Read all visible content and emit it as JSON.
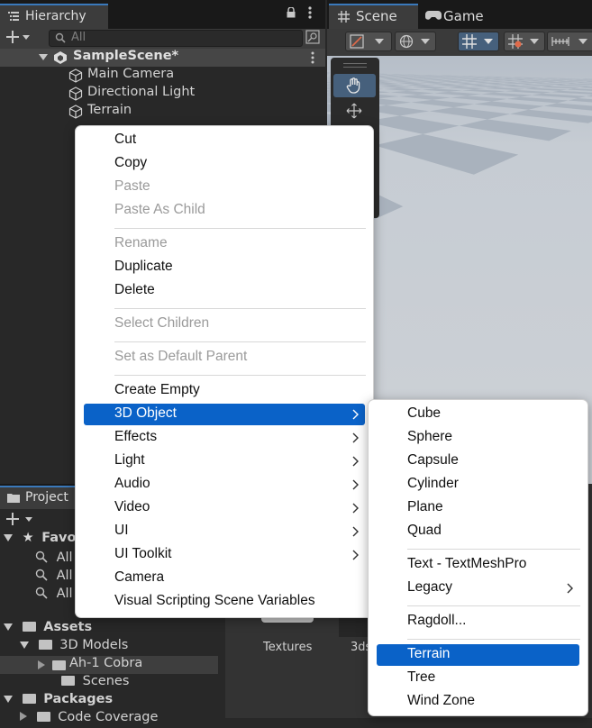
{
  "hierarchy": {
    "tab_label": "Hierarchy",
    "search_placeholder": "All",
    "scene_name": "SampleScene*",
    "items": [
      "Main Camera",
      "Directional Light",
      "Terrain"
    ]
  },
  "scene_view": {
    "tabs": [
      {
        "label": "Scene"
      },
      {
        "label": "Game"
      }
    ]
  },
  "project": {
    "tab_label": "Project",
    "favorites_label": "Favorites",
    "favorites_visible_label": "Favor",
    "favorite_items": [
      "All",
      "All",
      "All"
    ],
    "assets_label": "Assets",
    "models_label": "3D Models",
    "model_item": "Ah-1 Cobra",
    "scenes_label": "Scenes",
    "packages_label": "Packages",
    "packages_child": "Code Coverage",
    "files": [
      {
        "label": "Textures"
      },
      {
        "label": "3ds"
      }
    ]
  },
  "context_menu": {
    "groups": [
      [
        {
          "label": "Cut",
          "enabled": true
        },
        {
          "label": "Copy",
          "enabled": true
        },
        {
          "label": "Paste",
          "enabled": false
        },
        {
          "label": "Paste As Child",
          "enabled": false
        }
      ],
      [
        {
          "label": "Rename",
          "enabled": false
        },
        {
          "label": "Duplicate",
          "enabled": true
        },
        {
          "label": "Delete",
          "enabled": true
        }
      ],
      [
        {
          "label": "Select Children",
          "enabled": false
        }
      ],
      [
        {
          "label": "Set as Default Parent",
          "enabled": false
        }
      ],
      [
        {
          "label": "Create Empty",
          "enabled": true
        },
        {
          "label": "3D Object",
          "enabled": true,
          "submenu": true,
          "highlighted": true
        },
        {
          "label": "Effects",
          "enabled": true,
          "submenu": true
        },
        {
          "label": "Light",
          "enabled": true,
          "submenu": true
        },
        {
          "label": "Audio",
          "enabled": true,
          "submenu": true
        },
        {
          "label": "Video",
          "enabled": true,
          "submenu": true
        },
        {
          "label": "UI",
          "enabled": true,
          "submenu": true
        },
        {
          "label": "UI Toolkit",
          "enabled": true,
          "submenu": true
        },
        {
          "label": "Camera",
          "enabled": true
        },
        {
          "label": "Visual Scripting Scene Variables",
          "enabled": true
        }
      ]
    ]
  },
  "submenu_3d": {
    "groups": [
      [
        {
          "label": "Cube"
        },
        {
          "label": "Sphere"
        },
        {
          "label": "Capsule"
        },
        {
          "label": "Cylinder"
        },
        {
          "label": "Plane"
        },
        {
          "label": "Quad"
        }
      ],
      [
        {
          "label": "Text - TextMeshPro"
        },
        {
          "label": "Legacy",
          "submenu": true
        }
      ],
      [
        {
          "label": "Ragdoll..."
        }
      ],
      [
        {
          "label": "Terrain",
          "highlighted": true
        },
        {
          "label": "Tree"
        },
        {
          "label": "Wind Zone"
        }
      ]
    ]
  },
  "colors": {
    "menu_highlight": "#0a62c8",
    "tab_accent": "#3a79bb",
    "panel_bg": "#282828"
  }
}
